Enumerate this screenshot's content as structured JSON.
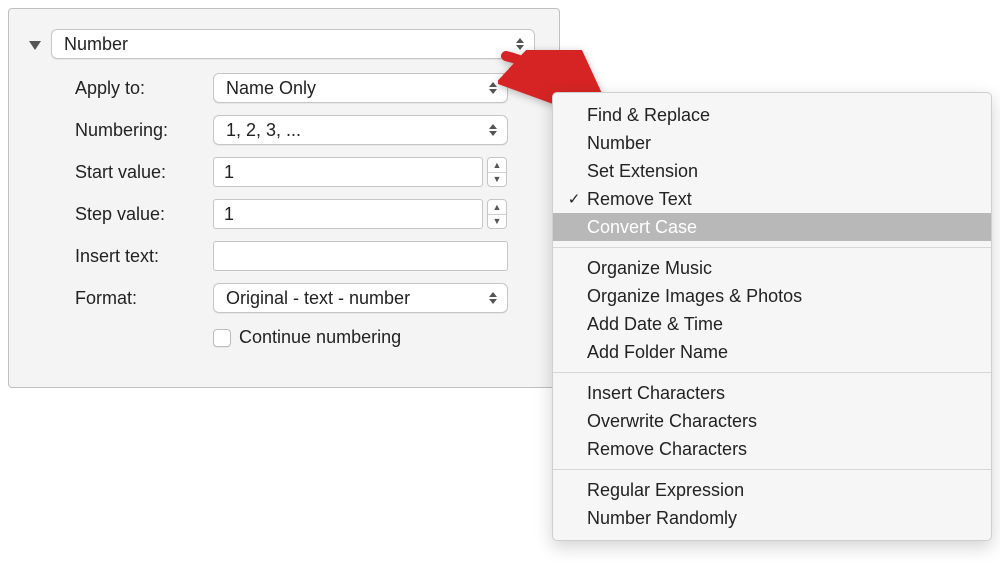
{
  "panel": {
    "action_type": "Number",
    "fields": {
      "apply_to_label": "Apply to:",
      "apply_to_value": "Name Only",
      "numbering_label": "Numbering:",
      "numbering_value": "1, 2, 3, ...",
      "start_value_label": "Start value:",
      "start_value": "1",
      "step_value_label": "Step value:",
      "step_value": "1",
      "insert_text_label": "Insert text:",
      "insert_text_value": "",
      "format_label": "Format:",
      "format_value": "Original - text - number",
      "continue_numbering_label": "Continue numbering",
      "continue_numbering_checked": false
    }
  },
  "menu": {
    "groups": [
      [
        {
          "label": "Find & Replace",
          "checked": false,
          "highlight": false
        },
        {
          "label": "Number",
          "checked": false,
          "highlight": false
        },
        {
          "label": "Set Extension",
          "checked": false,
          "highlight": false
        },
        {
          "label": "Remove Text",
          "checked": true,
          "highlight": false
        },
        {
          "label": "Convert Case",
          "checked": false,
          "highlight": true
        }
      ],
      [
        {
          "label": "Organize Music",
          "checked": false,
          "highlight": false
        },
        {
          "label": "Organize Images & Photos",
          "checked": false,
          "highlight": false
        },
        {
          "label": "Add Date & Time",
          "checked": false,
          "highlight": false
        },
        {
          "label": "Add Folder Name",
          "checked": false,
          "highlight": false
        }
      ],
      [
        {
          "label": "Insert Characters",
          "checked": false,
          "highlight": false
        },
        {
          "label": "Overwrite Characters",
          "checked": false,
          "highlight": false
        },
        {
          "label": "Remove Characters",
          "checked": false,
          "highlight": false
        }
      ],
      [
        {
          "label": "Regular Expression",
          "checked": false,
          "highlight": false
        },
        {
          "label": "Number Randomly",
          "checked": false,
          "highlight": false
        }
      ]
    ]
  },
  "arrow_color": "#d62424"
}
